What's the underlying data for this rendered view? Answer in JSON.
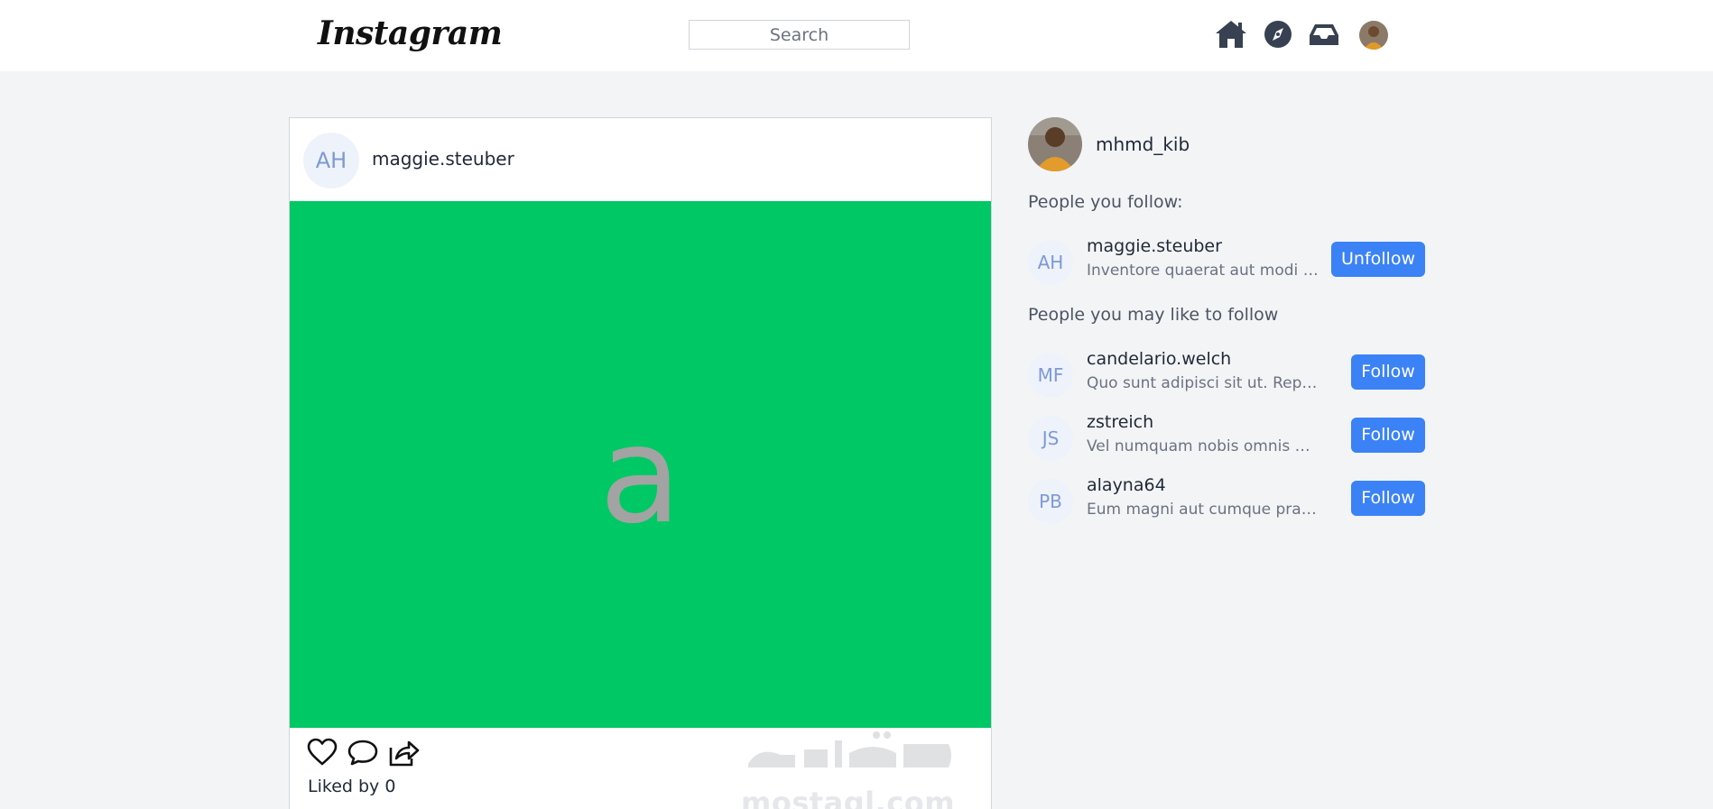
{
  "navbar": {
    "logo": "Instagram",
    "search_placeholder": "Search",
    "icons": [
      "home-icon",
      "compass-icon",
      "inbox-icon",
      "profile-avatar"
    ]
  },
  "post": {
    "avatar_initials": "AH",
    "username": "maggie.steuber",
    "image_text": "a",
    "image_color": "#00c864",
    "liked_by": "Liked by 0",
    "watermark_text": "mostaql.com"
  },
  "sidebar": {
    "me": {
      "username": "mhmd_kib"
    },
    "following_title": "People you follow:",
    "following": [
      {
        "initials": "AH",
        "username": "maggie.steuber",
        "bio": "Inventore quaerat aut modi con...",
        "button": "Unfollow"
      }
    ],
    "suggest_title": "People you may like to follow",
    "suggestions": [
      {
        "initials": "MF",
        "username": "candelario.welch",
        "bio": "Quo sunt adipisci sit ut. Repreh...",
        "button": "Follow"
      },
      {
        "initials": "JS",
        "username": "zstreich",
        "bio": "Vel numquam nobis omnis mini...",
        "button": "Follow"
      },
      {
        "initials": "PB",
        "username": "alayna64",
        "bio": "Eum magni aut cumque praese...",
        "button": "Follow"
      }
    ]
  },
  "colors": {
    "accent": "#3b82f6",
    "page_bg": "#f3f4f6",
    "initials_bg": "#eef2fb",
    "initials_fg": "#7c9ad6"
  }
}
